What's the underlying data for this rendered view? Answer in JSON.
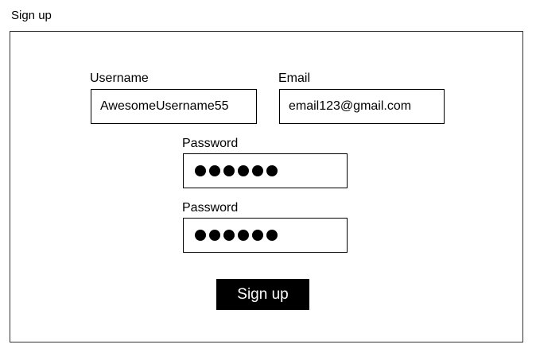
{
  "page": {
    "title": "Sign up"
  },
  "form": {
    "username": {
      "label": "Username",
      "value": "AwesomeUsername55"
    },
    "email": {
      "label": "Email",
      "value": "email123@gmail.com"
    },
    "password": {
      "label": "Password",
      "masked_length": 6
    },
    "confirm_password": {
      "label": "Password",
      "masked_length": 6
    },
    "submit_label": "Sign up"
  },
  "colors": {
    "border": "#000000",
    "button_bg": "#000000",
    "button_text": "#ffffff"
  }
}
